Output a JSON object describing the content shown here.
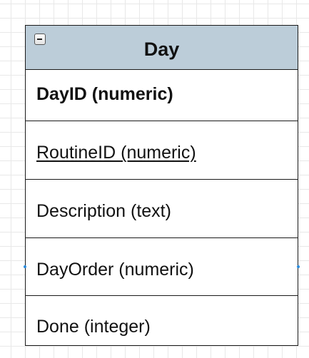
{
  "entity": {
    "title": "Day",
    "attributes": [
      {
        "label": "DayID (numeric)",
        "style": "bold"
      },
      {
        "label": "RoutineID (numeric)",
        "style": "underline"
      },
      {
        "label": "Description (text)",
        "style": "normal"
      },
      {
        "label": "DayOrder (numeric)",
        "style": "normal"
      },
      {
        "label": "Done (integer)",
        "style": "normal"
      }
    ]
  },
  "colors": {
    "header": "#bccdd9",
    "border": "#1a1a1a",
    "grid": "#e8e8e8",
    "connector": "#2a8de0"
  },
  "icons": {
    "collapse": "minus-box-icon"
  }
}
